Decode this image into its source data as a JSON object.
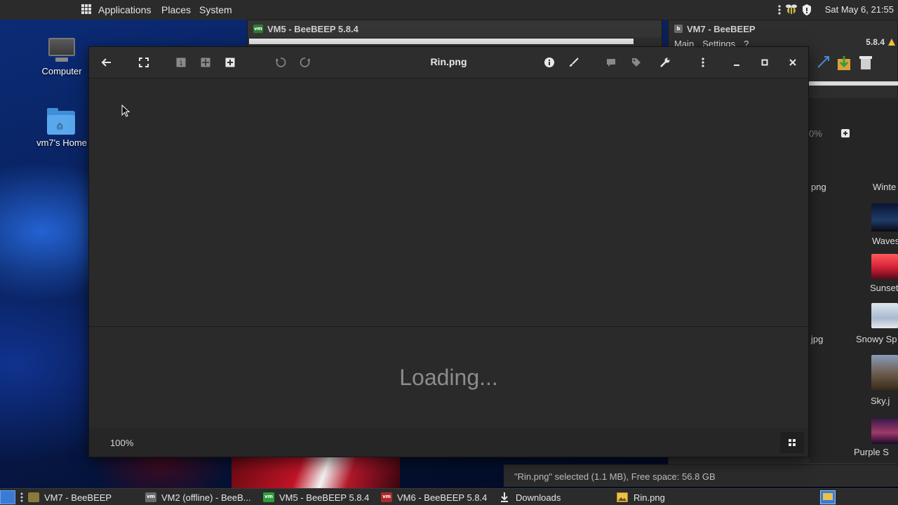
{
  "top_panel": {
    "menu": {
      "applications": "Applications",
      "places": "Places",
      "system": "System"
    },
    "clock": "Sat May 6, 21:55"
  },
  "desktop": {
    "icons": [
      {
        "label": "Computer"
      },
      {
        "label": "vm7's Home"
      }
    ]
  },
  "background_windows": {
    "vm5_title": "VM5 - BeeBEEP 5.8.4",
    "vm7_title": "VM7 - BeeBEEP",
    "vm7_menu": [
      "Main",
      "Settings",
      "?"
    ],
    "vm7_version": "5.8.4",
    "zoom_fragment": "0%",
    "file_labels_left": [
      "png",
      "jpg"
    ],
    "thumbnails": [
      "Winte",
      "Waves",
      "Sunset",
      "Snowy Sp",
      "Sky.j",
      "Purple S"
    ],
    "status": "\"Rin.png\" selected (1.1 MB), Free space: 56.8 GB"
  },
  "image_viewer": {
    "title": "Rin.png",
    "loading_text": "Loading...",
    "zoom": "100%"
  },
  "taskbar": {
    "tasks": [
      {
        "label": "VM7 - BeeBEEP"
      },
      {
        "label": "VM2 (offline) - BeeB..."
      },
      {
        "label": "VM5 - BeeBEEP 5.8.4"
      },
      {
        "label": "VM6 - BeeBEEP 5.8.4"
      },
      {
        "label": "Downloads"
      },
      {
        "label": "Rin.png"
      }
    ]
  },
  "colors": {
    "panel": "#2b2b2b",
    "window": "#2a2a2a",
    "accent": "#3f8fd8"
  }
}
